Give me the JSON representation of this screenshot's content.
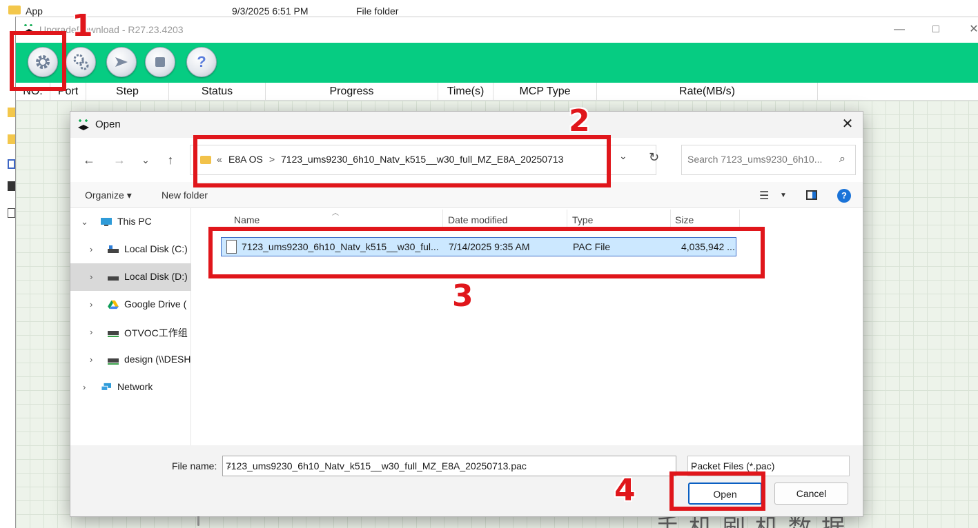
{
  "background_explorer": {
    "row": {
      "name": "App",
      "date": "9/3/2025 6:51 PM",
      "type": "File folder"
    }
  },
  "upgrade_window": {
    "title": "UpgradeDownload - R27.23.4203",
    "toolbar": {
      "load_packet_icon": "gear-icon",
      "settings_icon": "gears-icon",
      "start_icon": "play-arrow-icon",
      "stop_icon": "stop-square-icon",
      "help_icon": "?"
    },
    "columns": [
      "NO.",
      "Port",
      "Step",
      "Status",
      "Progress",
      "Time(s)",
      "MCP Type",
      "Rate(MB/s)"
    ],
    "watermark_text": "手机刷机数据"
  },
  "open_dialog": {
    "title": "Open",
    "breadcrumb": [
      "«",
      "E8A OS",
      ">",
      "7123_ums9230_6h10_Natv_k515__w30_full_MZ_E8A_20250713"
    ],
    "search_placeholder": "Search 7123_ums9230_6h10...",
    "commands": {
      "organize": "Organize",
      "new_folder": "New folder"
    },
    "nav_tree": [
      {
        "label": "This PC",
        "icon": "monitor-icon",
        "expanded": true
      },
      {
        "label": "Local Disk (C:)",
        "icon": "drive-icon"
      },
      {
        "label": "Local Disk (D:)",
        "icon": "drive-icon",
        "selected": true
      },
      {
        "label": "Google Drive (",
        "icon": "google-drive-icon"
      },
      {
        "label": "OTVOC工作组",
        "icon": "network-drive-icon"
      },
      {
        "label": "design (\\\\DESH",
        "icon": "network-drive-icon"
      },
      {
        "label": "Network",
        "icon": "network-icon"
      }
    ],
    "file_columns": {
      "name": "Name",
      "date": "Date modified",
      "type": "Type",
      "size": "Size"
    },
    "files": [
      {
        "name": "7123_ums9230_6h10_Natv_k515__w30_ful...",
        "date": "7/14/2025 9:35 AM",
        "type": "PAC File",
        "size": "4,035,942 ..."
      }
    ],
    "file_name_label": "File name:",
    "file_name_value": "7123_ums9230_6h10_Natv_k515__w30_full_MZ_E8A_20250713.pac",
    "file_type_value": "Packet Files (*.pac)",
    "open_button": "Open",
    "cancel_button": "Cancel"
  },
  "annotations": [
    "1",
    "2",
    "3",
    "4"
  ],
  "colors": {
    "toolbar_green": "#06cc82",
    "annotation_red": "#e0161b",
    "selection_blue": "#cce8ff"
  }
}
